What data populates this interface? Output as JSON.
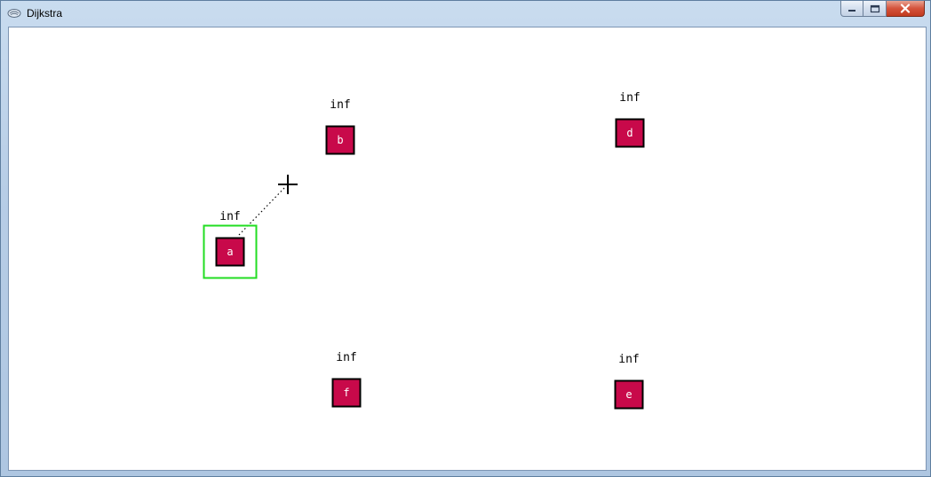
{
  "window": {
    "title": "Dijkstra",
    "app_icon": "app-icon",
    "controls": {
      "minimize_icon": "minimize-icon",
      "maximize_icon": "maximize-icon",
      "close_icon": "close-icon"
    }
  },
  "colors": {
    "node_fill": "#c8094a",
    "node_border": "#000000",
    "selection": "#22dd22",
    "node_text": "#ffffff",
    "distance_text": "#000000"
  },
  "graph": {
    "nodes": [
      {
        "id": "a",
        "name": "a",
        "distance": "inf",
        "selected": true
      },
      {
        "id": "b",
        "name": "b",
        "distance": "inf",
        "selected": false
      },
      {
        "id": "d",
        "name": "d",
        "distance": "inf",
        "selected": false
      },
      {
        "id": "f",
        "name": "f",
        "distance": "inf",
        "selected": false
      },
      {
        "id": "e",
        "name": "e",
        "distance": "inf",
        "selected": false
      }
    ],
    "pending_edge_from": "a",
    "cursor": "crosshair-icon"
  }
}
